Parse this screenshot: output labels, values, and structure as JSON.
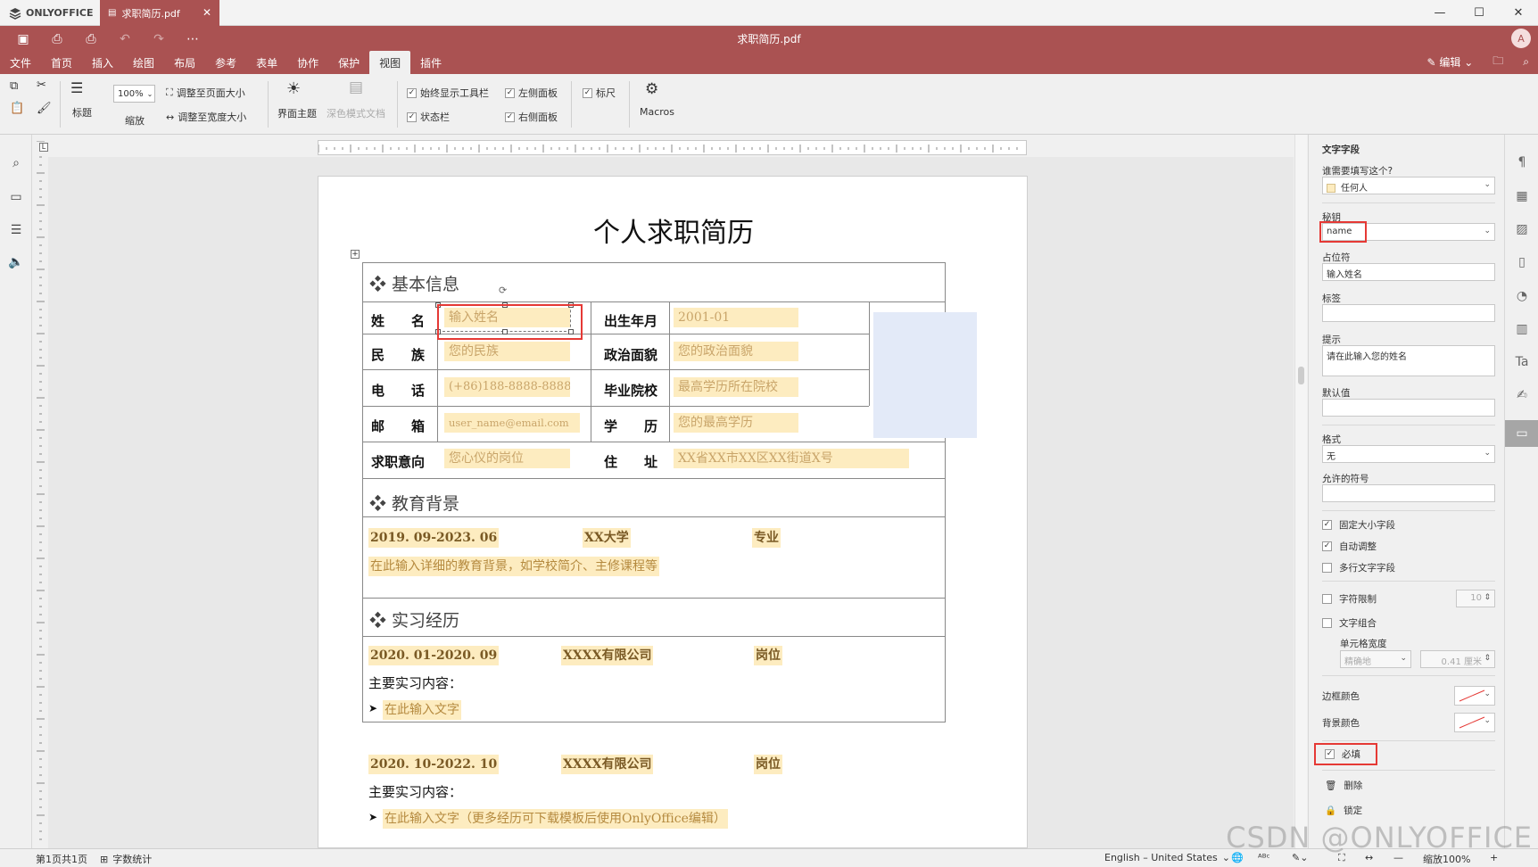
{
  "titlebar": {
    "brand": "ONLYOFFICE",
    "tab_label": "求职简历.pdf",
    "window_controls": [
      "minimize-icon",
      "maximize-icon",
      "close-icon"
    ]
  },
  "appbar": {
    "doc_title": "求职简历.pdf",
    "avatar_letter": "A",
    "menu_tabs": [
      "文件",
      "首页",
      "插入",
      "绘图",
      "布局",
      "参考",
      "表单",
      "协作",
      "保护",
      "视图",
      "插件"
    ],
    "active_tab": "视图",
    "edit_label": "编辑",
    "accent_color": "#aa5252"
  },
  "ribbon": {
    "zoom_value": "100%",
    "zoom_label": "缩放",
    "heading_label": "标题",
    "fit_page": "调整至页面大小",
    "fit_width": "调整至宽度大小",
    "theme_label": "界面主题",
    "dark_doc_label": "深色模式文档",
    "always_toolbar": "始终显示工具栏",
    "statusbar": "状态栏",
    "left_panel": "左侧面板",
    "right_panel": "右侧面板",
    "ruler": "标尺",
    "macros": "Macros"
  },
  "document": {
    "title": "个人求职简历",
    "section_basic": "基本信息",
    "section_edu": "教育背景",
    "section_intern": "实习经历",
    "labels": {
      "name": "姓　　名",
      "birth": "出生年月",
      "ethnic": "民　　族",
      "political": "政治面貌",
      "phone": "电　　话",
      "school": "毕业院校",
      "email": "邮　　箱",
      "degree": "学　　历",
      "intent": "求职意向",
      "address": "住　　址"
    },
    "placeholders": {
      "name": "输入姓名",
      "birth": "2001-01",
      "ethnic": "您的民族",
      "political": "您的政治面貌",
      "phone": "(+86)188-8888-8888",
      "school": "最高学历所在院校",
      "email": "user_name@email.com",
      "degree": "您的最高学历",
      "intent": "您心仪的岗位",
      "address": "XX省XX市XX区XX街道X号"
    },
    "edu": {
      "period": "2019. 09-2023. 06",
      "school": "XX大学",
      "major": "专业",
      "detail": "在此输入详细的教育背景，如学校简介、主修课程等"
    },
    "intern1": {
      "period": "2020. 01-2020. 09",
      "company": "XXXX有限公司",
      "position": "岗位",
      "content_label": "主要实习内容：",
      "content": "在此输入文字"
    },
    "intern2": {
      "period": "2020. 10-2022. 10",
      "company": "XXXX有限公司",
      "position": "岗位",
      "content_label": "主要实习内容：",
      "content": "在此输入文字（更多经历可下载模板后使用OnlyOffice编辑）"
    }
  },
  "right_panel": {
    "title": "文字字段",
    "who_fills_label": "谁需要填写这个?",
    "who_fills_value": "任何人",
    "key_label": "秘钥",
    "key_value": "name",
    "placeholder_label": "占位符",
    "placeholder_value": "输入姓名",
    "tag_label": "标签",
    "tag_value": "",
    "tip_label": "提示",
    "tip_value": "请在此输入您的姓名",
    "default_label": "默认值",
    "default_value": "",
    "format_label": "格式",
    "format_value": "无",
    "allowed_label": "允许的符号",
    "allowed_value": "",
    "fixed_size": "固定大小字段",
    "autofit": "自动调整",
    "multiline": "多行文字字段",
    "char_limit": "字符限制",
    "char_limit_value": "10",
    "comb": "文字组合",
    "cell_width_label": "单元格宽度",
    "cell_width_mode": "精确地",
    "cell_width_value": "0.41 厘米",
    "border_color_label": "边框颜色",
    "bg_color_label": "背景颜色",
    "required": "必填",
    "delete": "删除",
    "lock": "锁定"
  },
  "statusbar": {
    "page_info": "第1页共1页",
    "word_count": "字数统计",
    "language": "English – United States",
    "zoom": "缩放100%"
  },
  "watermark": "CSDN @ONLYOFFICE"
}
